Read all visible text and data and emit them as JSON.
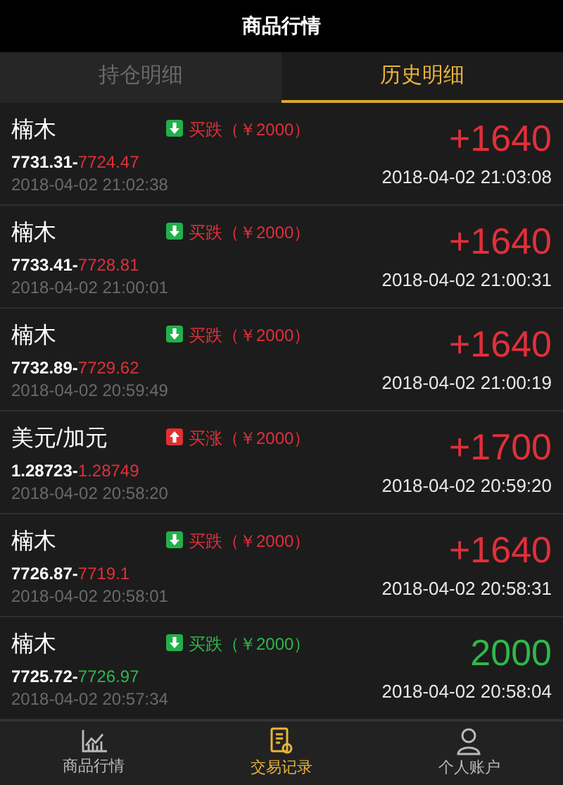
{
  "header": {
    "title": "商品行情"
  },
  "tabs": [
    {
      "label": "持仓明细",
      "selected": false
    },
    {
      "label": "历史明细",
      "selected": true
    }
  ],
  "trades": [
    {
      "name": "楠木",
      "kind": "down",
      "direction_label": "买跌",
      "amount": "（￥2000）",
      "open_price": "7731.31",
      "separator": "-",
      "close_price": "7724.47",
      "color": "#e0303a",
      "open_time": "2018-04-02 21:02:38",
      "profit": "+1640",
      "close_time": "2018-04-02 21:03:08"
    },
    {
      "name": "楠木",
      "kind": "down",
      "direction_label": "买跌",
      "amount": "（￥2000）",
      "open_price": "7733.41",
      "separator": "-",
      "close_price": "7728.81",
      "color": "#e0303a",
      "open_time": "2018-04-02 21:00:01",
      "profit": "+1640",
      "close_time": "2018-04-02 21:00:31"
    },
    {
      "name": "楠木",
      "kind": "down",
      "direction_label": "买跌",
      "amount": "（￥2000）",
      "open_price": "7732.89",
      "separator": "-",
      "close_price": "7729.62",
      "color": "#e0303a",
      "open_time": "2018-04-02 20:59:49",
      "profit": "+1640",
      "close_time": "2018-04-02 21:00:19"
    },
    {
      "name": "美元/加元",
      "kind": "up",
      "direction_label": "买涨",
      "amount": "（￥2000）",
      "open_price": "1.28723",
      "separator": "-",
      "close_price": "1.28749",
      "color": "#e0303a",
      "open_time": "2018-04-02 20:58:20",
      "profit": "+1700",
      "close_time": "2018-04-02 20:59:20"
    },
    {
      "name": "楠木",
      "kind": "down",
      "direction_label": "买跌",
      "amount": "（￥2000）",
      "open_price": "7726.87",
      "separator": "-",
      "close_price": "7719.1",
      "color": "#e0303a",
      "open_time": "2018-04-02 20:58:01",
      "profit": "+1640",
      "close_time": "2018-04-02 20:58:31"
    },
    {
      "name": "楠木",
      "kind": "down",
      "direction_label": "买跌",
      "amount": "（￥2000）",
      "open_price": "7725.72",
      "separator": "-",
      "close_price": "7726.97",
      "color": "#2db84a",
      "open_time": "2018-04-02 20:57:34",
      "profit": "2000",
      "close_time": "2018-04-02 20:58:04"
    }
  ],
  "bottom_nav": [
    {
      "label": "商品行情",
      "selected": false
    },
    {
      "label": "交易记录",
      "selected": true
    },
    {
      "label": "个人账户",
      "selected": false
    }
  ]
}
